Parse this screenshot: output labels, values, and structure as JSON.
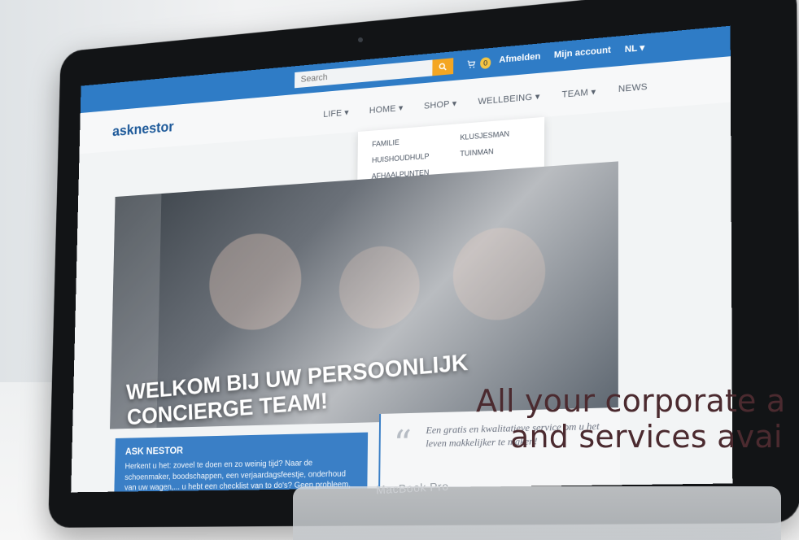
{
  "site": {
    "logo": "asknestor",
    "search": {
      "placeholder": "Search"
    },
    "cart": {
      "count": "0"
    },
    "top_links": [
      "Afmelden",
      "Mijn account",
      "NL"
    ],
    "nav": [
      "LIFE",
      "HOME",
      "SHOP",
      "WELLBEING",
      "TEAM",
      "NEWS"
    ],
    "dropdown": {
      "left": [
        "FAMILIE",
        "HUISHOUDHULP",
        "AFHAALPUNTEN"
      ],
      "right": [
        "KLUSJESMAN",
        "TUINMAN"
      ]
    },
    "hero_title": "WELKOM BIJ UW PERSOONLIJK CONCIERGE TEAM!",
    "info": {
      "heading": "ASK NESTOR",
      "text": "Herkent u het: zoveel te doen en zo weinig tijd? Naar de schoenmaker, boodschappen, een verjaardagsfeestje, onderhoud van uw wagen,... u hebt een checklist van to do's? Geen probleem, Ask Nestor helpt u verder."
    },
    "quote": "Een gratis en kwalitatieve service om u het leven makkelijker te maken!"
  },
  "device": {
    "brand": "MacBook Pro"
  },
  "overlay": {
    "line1": "All your corporate a",
    "line2": "and services avai"
  },
  "colors": {
    "primary_blue": "#2f7cc6",
    "accent_orange": "#f4a623",
    "overlay_text": "#4b2a2f"
  }
}
